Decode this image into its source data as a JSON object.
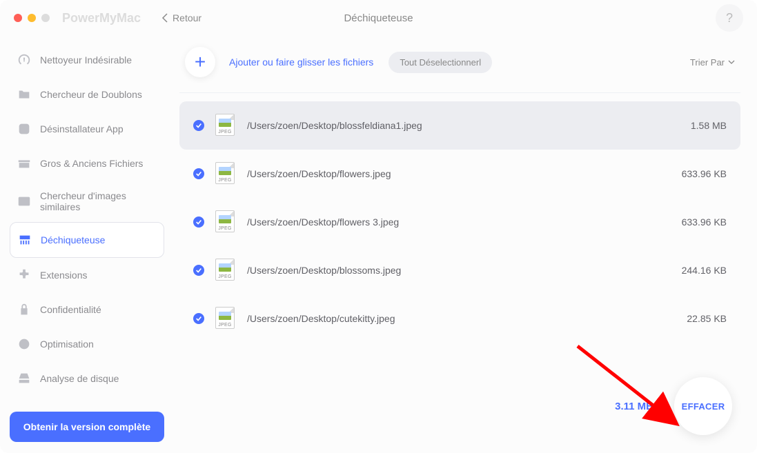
{
  "header": {
    "app_name": "PowerMyMac",
    "back_label": "Retour",
    "page_title": "Déchiqueteuse",
    "help_label": "?"
  },
  "sidebar": {
    "items": [
      {
        "label": "Nettoyeur Indésirable"
      },
      {
        "label": "Chercheur de Doublons"
      },
      {
        "label": "Désinstallateur App"
      },
      {
        "label": "Gros & Anciens Fichiers"
      },
      {
        "label": "Chercheur d'images similaires"
      },
      {
        "label": "Déchiqueteuse"
      },
      {
        "label": "Extensions"
      },
      {
        "label": "Confidentialité"
      },
      {
        "label": "Optimisation"
      },
      {
        "label": "Analyse de disque"
      }
    ],
    "full_version": "Obtenir la version complète"
  },
  "toolbar": {
    "add_label": "Ajouter ou faire glisser les fichiers",
    "deselect_label": "Tout Déselectionnerl",
    "sort_label": "Trier Par"
  },
  "files": [
    {
      "path": "/Users/zoen/Desktop/blossfeldiana1.jpeg",
      "size": "1.58 MB",
      "ext": "JPEG"
    },
    {
      "path": "/Users/zoen/Desktop/flowers.jpeg",
      "size": "633.96 KB",
      "ext": "JPEG"
    },
    {
      "path": "/Users/zoen/Desktop/flowers 3.jpeg",
      "size": "633.96 KB",
      "ext": "JPEG"
    },
    {
      "path": "/Users/zoen/Desktop/blossoms.jpeg",
      "size": "244.16 KB",
      "ext": "JPEG"
    },
    {
      "path": "/Users/zoen/Desktop/cutekitty.jpeg",
      "size": "22.85 KB",
      "ext": "JPEG"
    }
  ],
  "footer": {
    "total_size": "3.11 MB",
    "erase_label": "EFFACER"
  }
}
